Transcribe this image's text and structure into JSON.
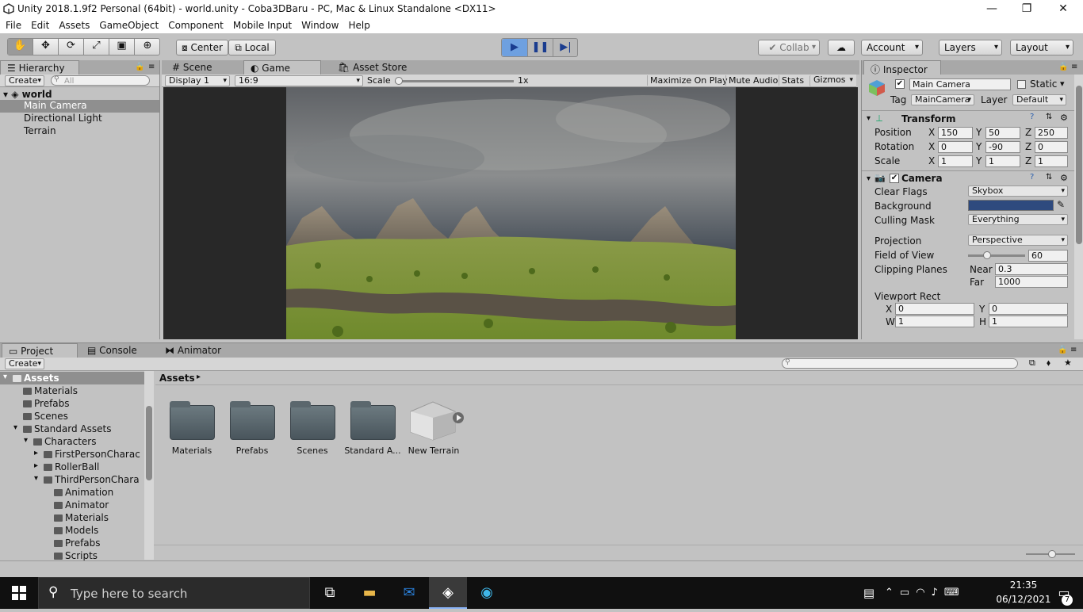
{
  "window": {
    "title": "Unity 2018.1.9f2 Personal (64bit) - world.unity - Coba3DBaru - PC, Mac & Linux Standalone <DX11>",
    "controls": [
      "—",
      "❐",
      "✕"
    ]
  },
  "menu": [
    "File",
    "Edit",
    "Assets",
    "GameObject",
    "Component",
    "Mobile Input",
    "Window",
    "Help"
  ],
  "toolbar": {
    "center_label": "Center",
    "local_label": "Local",
    "collab_label": "Collab",
    "account_label": "Account",
    "layers_label": "Layers",
    "layout_label": "Layout"
  },
  "hierarchy": {
    "tab": "Hierarchy",
    "create": "Create",
    "search_placeholder": "All",
    "scene": "world",
    "items": [
      "Main Camera",
      "Directional Light",
      "Terrain"
    ]
  },
  "center_tabs": [
    "Scene",
    "Game",
    "Asset Store"
  ],
  "game_bar": {
    "display": "Display 1",
    "aspect": "16:9",
    "scale_label": "Scale",
    "scale_value": "1x",
    "scale_level": 0.0,
    "maximize": "Maximize On Play",
    "mute": "Mute Audio",
    "stats": "Stats",
    "gizmos": "Gizmos"
  },
  "inspector": {
    "tab": "Inspector",
    "name": "Main Camera",
    "static_label": "Static",
    "tag_label": "Tag",
    "tag_value": "MainCamera",
    "layer_label": "Layer",
    "layer_value": "Default",
    "transform": {
      "title": "Transform",
      "position_label": "Position",
      "rotation_label": "Rotation",
      "scale_label": "Scale",
      "position": [
        "150",
        "50",
        "250"
      ],
      "rotation": [
        "0",
        "-90",
        "0"
      ],
      "scale": [
        "1",
        "1",
        "1"
      ],
      "axis_x": "X",
      "axis_y": "Y",
      "axis_z": "Z"
    },
    "camera": {
      "title": "Camera",
      "clear_flags_label": "Clear Flags",
      "clear_flags": "Skybox",
      "background_label": "Background",
      "background_color": "#2e4a7e",
      "culling_label": "Culling Mask",
      "culling": "Everything",
      "projection_label": "Projection",
      "projection": "Perspective",
      "fov_label": "Field of View",
      "fov": "60",
      "fov_level": 0.333,
      "clipping_label": "Clipping Planes",
      "near_label": "Near",
      "near": "0.3",
      "far_label": "Far",
      "far": "1000",
      "viewport_label": "Viewport Rect",
      "vx_label": "X",
      "vx": "0",
      "vy_label": "Y",
      "vy": "0",
      "vw_label": "W",
      "vw": "1",
      "vh_label": "H",
      "vh": "1"
    }
  },
  "bottom_tabs": [
    "Project",
    "Console",
    "Animator"
  ],
  "project": {
    "create": "Create",
    "tree": [
      {
        "label": "Assets",
        "depth": 0,
        "selected": true,
        "expanded": true
      },
      {
        "label": "Materials",
        "depth": 1
      },
      {
        "label": "Prefabs",
        "depth": 1
      },
      {
        "label": "Scenes",
        "depth": 1
      },
      {
        "label": "Standard Assets",
        "depth": 1,
        "expanded": true
      },
      {
        "label": "Characters",
        "depth": 2,
        "expanded": true
      },
      {
        "label": "FirstPersonCharac",
        "depth": 3,
        "collapsed": true
      },
      {
        "label": "RollerBall",
        "depth": 3,
        "collapsed": true
      },
      {
        "label": "ThirdPersonChara",
        "depth": 3,
        "expanded": true
      },
      {
        "label": "Animation",
        "depth": 4
      },
      {
        "label": "Animator",
        "depth": 4
      },
      {
        "label": "Materials",
        "depth": 4
      },
      {
        "label": "Models",
        "depth": 4
      },
      {
        "label": "Prefabs",
        "depth": 4
      },
      {
        "label": "Scripts",
        "depth": 4
      }
    ],
    "breadcrumb": "Assets",
    "assets": [
      "Materials",
      "Prefabs",
      "Scenes",
      "Standard A...",
      "New Terrain"
    ]
  },
  "taskbar": {
    "search_placeholder": "Type here to search",
    "time": "21:35",
    "date": "06/12/2021",
    "notification_count": "7"
  }
}
